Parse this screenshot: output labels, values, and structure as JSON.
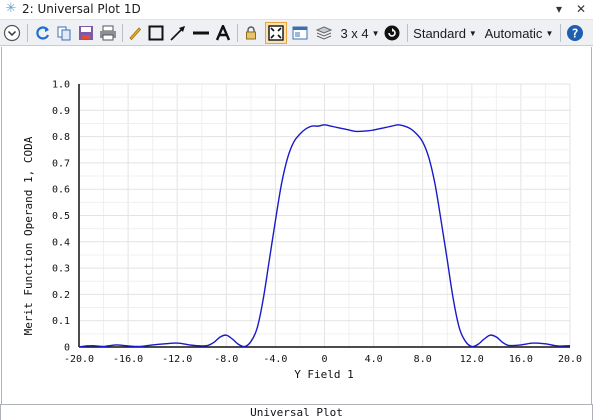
{
  "window": {
    "title": "2: Universal Plot 1D",
    "pin_glyph": "▾",
    "close_glyph": "✕"
  },
  "toolbar": {
    "layout_label": "3 x 4",
    "style_label": "Standard",
    "scale_label": "Automatic"
  },
  "footer": {
    "label": "Universal Plot"
  },
  "colors": {
    "curve": "#1a1ac8",
    "grid": "#e6e6e6",
    "highlight": "#f5a623"
  },
  "chart_data": {
    "type": "line",
    "xlabel": "Y Field 1",
    "ylabel": "Merit Function Operand 1, CODA",
    "xlim": [
      -20,
      20
    ],
    "ylim": [
      0,
      1
    ],
    "x_ticks": [
      "-20.0",
      "-16.0",
      "-12.0",
      "-8.0",
      "-4.0",
      "0",
      "4.0",
      "8.0",
      "12.0",
      "16.0",
      "20.0"
    ],
    "y_ticks": [
      "0",
      "0.1",
      "0.2",
      "0.3",
      "0.4",
      "0.5",
      "0.6",
      "0.7",
      "0.8",
      "0.9",
      "1.0"
    ],
    "grid": true,
    "series": [
      {
        "x": [
          -20,
          -19,
          -18,
          -17,
          -16,
          -15,
          -14,
          -13,
          -12,
          -11,
          -10,
          -9.5,
          -9,
          -8.5,
          -8,
          -7.5,
          -7,
          -6.5,
          -6,
          -5.5,
          -5,
          -4.5,
          -4,
          -3.5,
          -3,
          -2.5,
          -2,
          -1.5,
          -1,
          -0.5,
          0,
          0.5,
          1,
          1.5,
          2,
          2.5,
          3,
          3.5,
          4,
          4.5,
          5,
          5.5,
          6,
          6.5,
          7,
          7.5,
          8,
          8.5,
          9,
          9.5,
          10,
          10.5,
          11,
          11.5,
          12,
          12.5,
          13,
          13.5,
          14,
          14.5,
          15,
          16,
          17,
          18,
          19,
          20
        ],
        "y": [
          0.001,
          0.005,
          0.002,
          0.008,
          0.004,
          0.002,
          0.008,
          0.012,
          0.015,
          0.008,
          0.004,
          0.006,
          0.018,
          0.038,
          0.045,
          0.03,
          0.01,
          0.002,
          0.02,
          0.07,
          0.18,
          0.33,
          0.48,
          0.62,
          0.72,
          0.78,
          0.81,
          0.83,
          0.84,
          0.84,
          0.845,
          0.84,
          0.835,
          0.83,
          0.825,
          0.82,
          0.82,
          0.822,
          0.825,
          0.83,
          0.835,
          0.84,
          0.845,
          0.84,
          0.83,
          0.81,
          0.78,
          0.72,
          0.62,
          0.48,
          0.33,
          0.18,
          0.07,
          0.02,
          0.002,
          0.01,
          0.03,
          0.045,
          0.038,
          0.018,
          0.006,
          0.008,
          0.015,
          0.012,
          0.004,
          0.005
        ]
      }
    ]
  }
}
